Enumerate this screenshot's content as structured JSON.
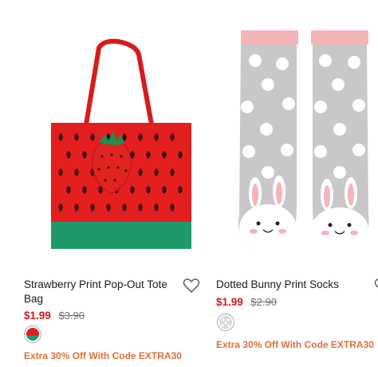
{
  "products": [
    {
      "name": "Strawberry Print Pop-Out Tote Bag",
      "sale_price": "$1.99",
      "original_price": "$3.90",
      "promo": "Extra 30% Off With Code EXTRA30",
      "colors": {
        "bag": "#e31e1e",
        "band": "#1e9a6a",
        "strap": "#d81b1b"
      }
    },
    {
      "name": "Dotted Bunny Print Socks",
      "sale_price": "$1.99",
      "original_price": "$2.90",
      "promo": "Extra 30% Off With Code EXTRA30",
      "colors": {
        "sock": "#c8c8c8",
        "cuff": "#f4b5b9",
        "dot": "#ffffff"
      }
    }
  ],
  "icons": {
    "wishlist": "heart-outline-icon"
  }
}
